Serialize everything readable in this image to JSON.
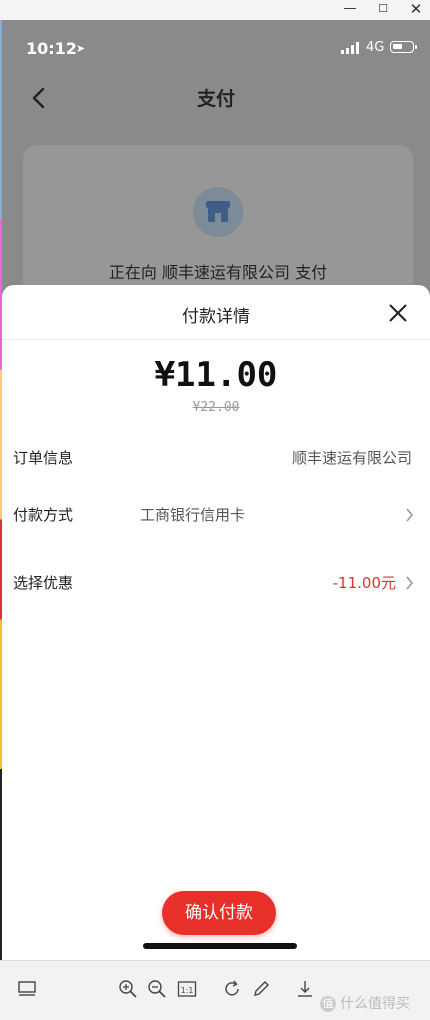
{
  "window": {
    "controls": {
      "minimize": "—",
      "maximize": "☐",
      "close": "✕"
    }
  },
  "status_bar": {
    "time": "10:12",
    "network": "4G"
  },
  "page": {
    "title": "支付"
  },
  "merchant": {
    "paying_text": "正在向 顺丰速运有限公司 支付"
  },
  "sheet": {
    "title": "付款详情",
    "amount": "¥11.00",
    "original_amount": "¥22.00",
    "rows": [
      {
        "label": "订单信息",
        "value": "顺丰速运有限公司"
      },
      {
        "label": "付款方式",
        "value": "工商银行信用卡"
      },
      {
        "label": "选择优惠",
        "value": "-11.00元"
      }
    ],
    "confirm_label": "确认付款"
  },
  "watermark": {
    "badge": "值",
    "text": "什么值得买"
  },
  "colors": {
    "accent": "#e8302a",
    "discount": "#d8342b",
    "overlay": "#8a8a8a"
  }
}
